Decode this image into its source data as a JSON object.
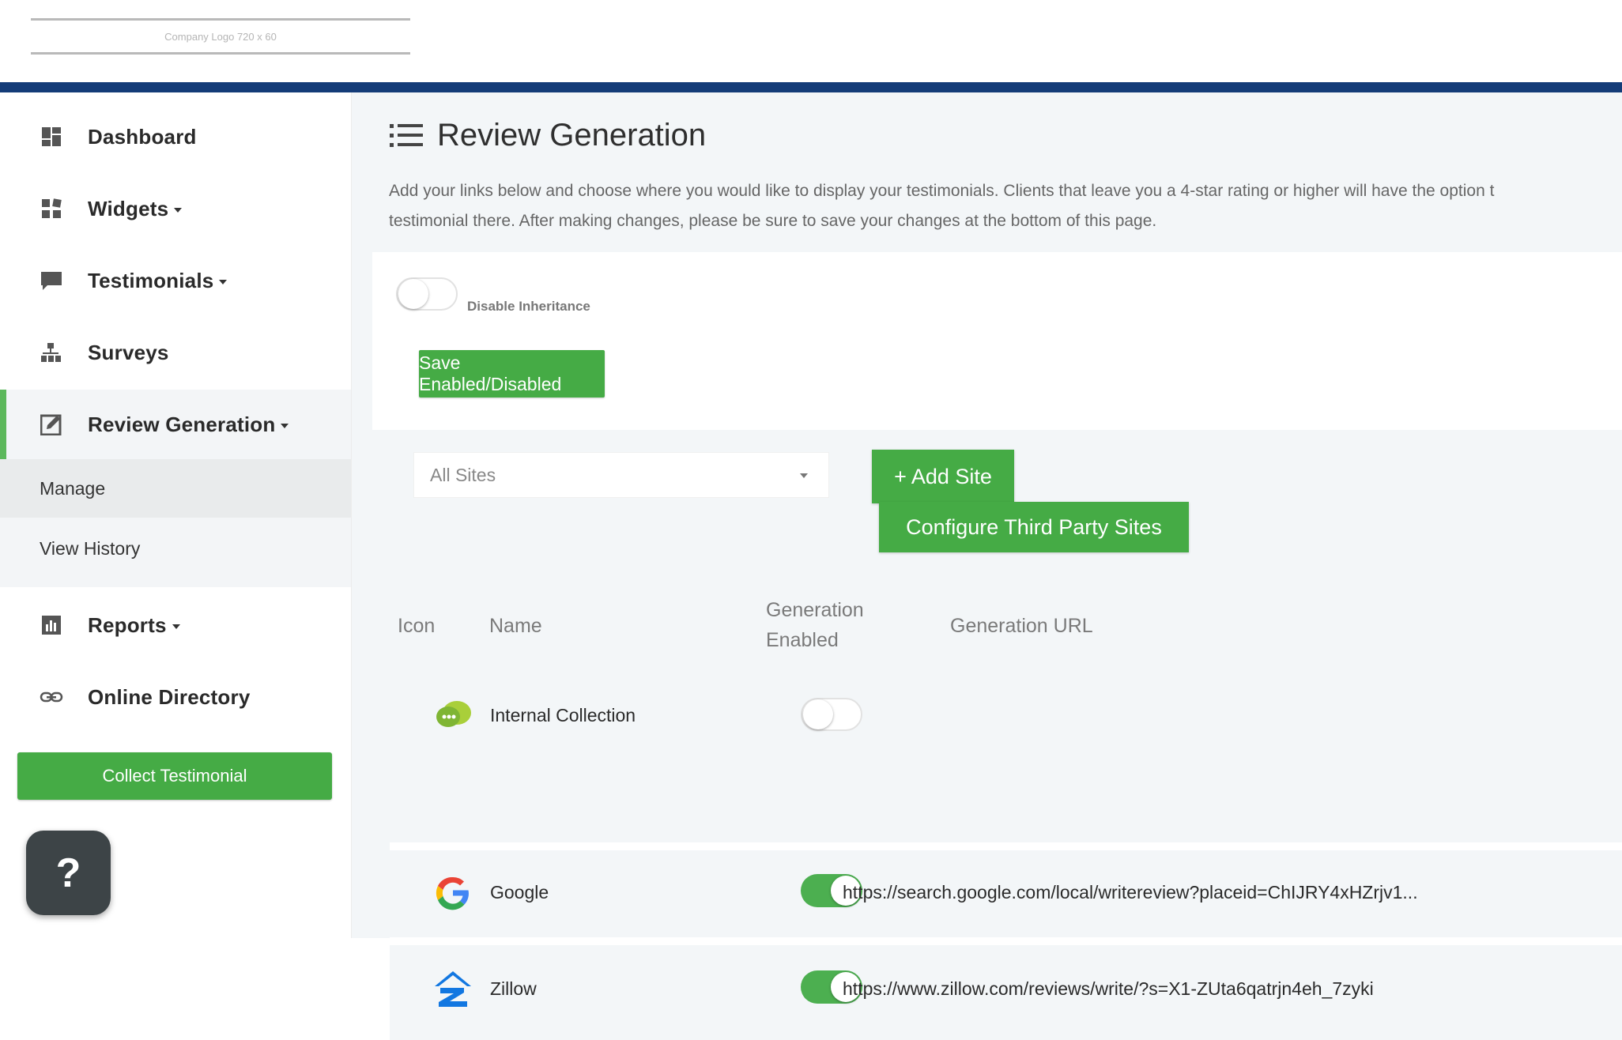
{
  "header": {
    "logo_placeholder": "Company Logo 720 x 60"
  },
  "sidebar": {
    "items": [
      {
        "label": "Dashboard",
        "icon": "dashboard-icon",
        "has_caret": false
      },
      {
        "label": "Widgets",
        "icon": "widgets-icon",
        "has_caret": true
      },
      {
        "label": "Testimonials",
        "icon": "chat-icon",
        "has_caret": true
      },
      {
        "label": "Surveys",
        "icon": "sitemap-icon",
        "has_caret": false
      },
      {
        "label": "Review Generation",
        "icon": "edit-icon",
        "has_caret": true
      },
      {
        "label": "Reports",
        "icon": "bar-chart-icon",
        "has_caret": true
      },
      {
        "label": "Online Directory",
        "icon": "link-icon",
        "has_caret": false
      }
    ],
    "sub_items": [
      {
        "label": "Manage"
      },
      {
        "label": "View History"
      }
    ],
    "collect_button": "Collect Testimonial",
    "help_button": "?"
  },
  "main": {
    "title": "Review Generation",
    "description_line1": "Add your links below and choose where you would like to display your testimonials. Clients that leave you a 4-star rating or higher will have the option t",
    "description_line2": "testimonial there. After making changes, please be sure to save your changes at the bottom of this page.",
    "inherit_label": "Disable Inheritance",
    "save_button": "Save Enabled/Disabled",
    "site_filter": {
      "selected": "All Sites"
    },
    "add_site_button": "+ Add Site",
    "configure_button": "Configure Third Party Sites",
    "table": {
      "headers": {
        "icon": "Icon",
        "name": "Name",
        "enabled_line1": "Generation",
        "enabled_line2": "Enabled",
        "url": "Generation URL"
      },
      "rows": [
        {
          "name": "Internal Collection",
          "enabled": false,
          "url": ""
        },
        {
          "name": "Google",
          "enabled": true,
          "url": "https://search.google.com/local/writereview?placeid=ChIJRY4xHZrjv1..."
        },
        {
          "name": "Zillow",
          "enabled": true,
          "url": "https://www.zillow.com/reviews/write/?s=X1-ZUta6qatrjn4eh_7zyki"
        }
      ]
    }
  },
  "colors": {
    "brand_green": "#45ab45",
    "header_navy": "#143c78",
    "toggle_on": "#4caf50",
    "help_dark": "#3d4447"
  }
}
